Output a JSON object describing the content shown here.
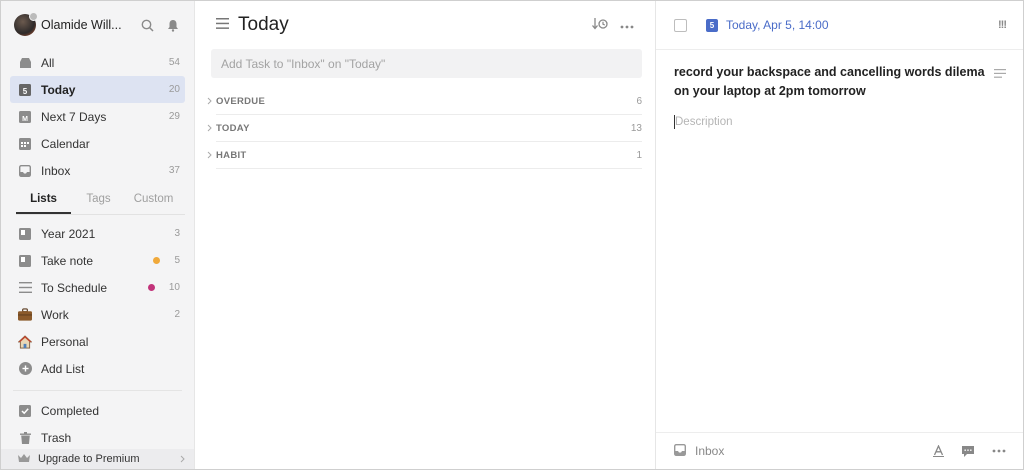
{
  "profile": {
    "name": "Olamide Will...",
    "icons": [
      "search-icon",
      "bell-icon"
    ]
  },
  "nav": [
    {
      "key": "all",
      "label": "All",
      "count": "54",
      "icon": "inbox-tray-icon"
    },
    {
      "key": "today",
      "label": "Today",
      "count": "20",
      "icon": "calendar-day-icon",
      "active": true
    },
    {
      "key": "next7",
      "label": "Next 7 Days",
      "count": "29",
      "icon": "calendar-week-icon"
    },
    {
      "key": "calendar",
      "label": "Calendar",
      "count": "",
      "icon": "calendar-icon"
    },
    {
      "key": "inbox",
      "label": "Inbox",
      "count": "37",
      "icon": "inbox-icon"
    }
  ],
  "tabs": [
    {
      "label": "Lists",
      "active": true
    },
    {
      "label": "Tags"
    },
    {
      "label": "Custom"
    }
  ],
  "lists": [
    {
      "label": "Year 2021",
      "count": "3",
      "icon": "list-icon"
    },
    {
      "label": "Take note",
      "count": "5",
      "icon": "list-icon",
      "dot": "#f0a93a"
    },
    {
      "label": "To Schedule",
      "count": "10",
      "icon": "lines-icon",
      "dot": "#c2337a"
    },
    {
      "label": "Work",
      "count": "2",
      "icon": "briefcase-icon"
    },
    {
      "label": "Personal",
      "count": "",
      "icon": "house-icon"
    },
    {
      "label": "Add List",
      "count": "",
      "icon": "plus-circle-icon"
    }
  ],
  "bottom": [
    {
      "label": "Completed",
      "icon": "check-square-icon"
    },
    {
      "label": "Trash",
      "icon": "trash-icon"
    }
  ],
  "premium": {
    "label": "Upgrade to Premium",
    "icon": "crown-icon"
  },
  "middle": {
    "title": "Today",
    "add_placeholder": "Add Task to \"Inbox\" on \"Today\"",
    "sections": [
      {
        "name": "OVERDUE",
        "count": "6"
      },
      {
        "name": "TODAY",
        "count": "13"
      },
      {
        "name": "HABIT",
        "count": "1"
      }
    ]
  },
  "detail": {
    "date_icon_text": "5",
    "date": "Today, Apr 5, 14:00",
    "priority": "!!!",
    "title": "record your backspace and cancelling words dilema on your laptop at 2pm tomorrow",
    "description_placeholder": "Description",
    "list_name": "Inbox"
  },
  "colors": {
    "accent": "#4a6cc8",
    "active_bg": "#dde3f2"
  }
}
